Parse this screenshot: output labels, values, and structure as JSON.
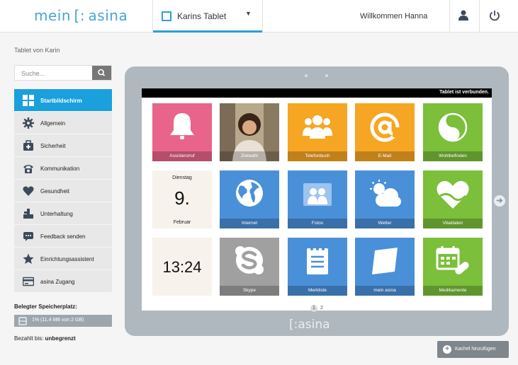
{
  "header": {
    "logo": "mein [: asina",
    "selected_tablet": "Karins Tablet",
    "welcome": "Willkommen Hanna"
  },
  "sidebar": {
    "device_title": "Tablet von Karin",
    "search_placeholder": "Suche...",
    "items": [
      {
        "label": "Startbildschirm",
        "icon": "grid-icon",
        "active": true
      },
      {
        "label": "Allgemein",
        "icon": "gear-icon"
      },
      {
        "label": "Sicherheit",
        "icon": "medkit-icon"
      },
      {
        "label": "Kommunikation",
        "icon": "phone-icon"
      },
      {
        "label": "Gesundheit",
        "icon": "heart-icon"
      },
      {
        "label": "Unterhaltung",
        "icon": "joystick-icon"
      },
      {
        "label": "Feedback senden",
        "icon": "chat-icon"
      },
      {
        "label": "Einrichtungsassistent",
        "icon": "star-icon"
      },
      {
        "label": "asina Zugang",
        "icon": "card-icon"
      }
    ],
    "storage_label": "Belegter Speicherplatz:",
    "storage_value": "1% (11,4 MB von 2 GB)",
    "paid_label": "Bezahlt bis:",
    "paid_value": "unbegrenzt"
  },
  "tablet": {
    "status": "Tablet ist verbunden.",
    "date": {
      "weekday": "Dienstag",
      "day": "9.",
      "month": "Februar"
    },
    "clock": "13:24",
    "pages": [
      "1",
      "2"
    ],
    "frame_logo": "[:asina",
    "tiles": [
      {
        "label": "Assistenzruf",
        "color": "#e8648a",
        "icon": "bell-icon"
      },
      {
        "label": "Zielwahl",
        "color": "#9b8a73",
        "icon": "portrait-photo"
      },
      {
        "label": "Telefonbuch",
        "color": "#f6a623",
        "icon": "people-icon"
      },
      {
        "label": "E-Mail",
        "color": "#f6a623",
        "icon": "at-icon"
      },
      {
        "label": "Wohlbefinden",
        "color": "#7bbf3a",
        "icon": "yinyang-icon"
      },
      {
        "label": "Internet",
        "color": "#4a90d9",
        "icon": "globe-icon"
      },
      {
        "label": "Fotos",
        "color": "#4a90d9",
        "icon": "photos-icon"
      },
      {
        "label": "Wetter",
        "color": "#4a90d9",
        "icon": "weather-icon"
      },
      {
        "label": "Vitaldaten",
        "color": "#7bbf3a",
        "icon": "vital-heart-icon"
      },
      {
        "label": "Skype",
        "color": "#a0a0a0",
        "icon": "skype-icon"
      },
      {
        "label": "Merkliste",
        "color": "#4a90d9",
        "icon": "notepad-icon"
      },
      {
        "label": "mein asina",
        "color": "#4a90d9",
        "icon": "mein-asina-icon"
      },
      {
        "label": "Medikamente",
        "color": "#7bbf3a",
        "icon": "medication-icon"
      }
    ]
  },
  "actions": {
    "add_tile": "Kachel hinzufügen"
  }
}
